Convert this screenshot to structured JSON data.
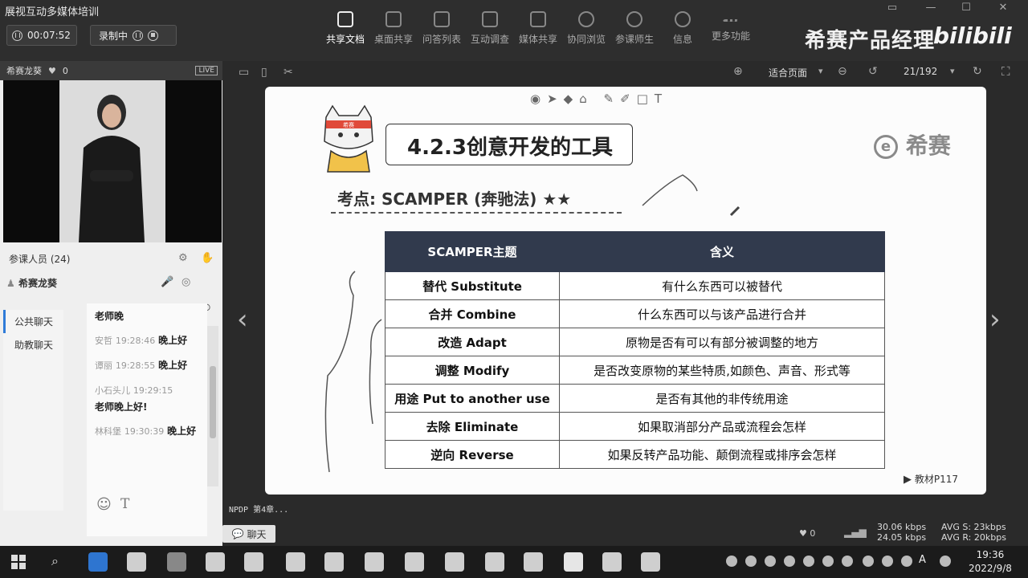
{
  "app": {
    "title": "展视互动多媒体培训",
    "timer": "00:07:52",
    "recording_label": "录制中"
  },
  "toolbar": [
    {
      "label": "共享文档",
      "icon": "document-icon",
      "active": true
    },
    {
      "label": "桌面共享",
      "icon": "desktop-share-icon"
    },
    {
      "label": "问答列表",
      "icon": "qa-icon"
    },
    {
      "label": "互动调查",
      "icon": "survey-icon"
    },
    {
      "label": "媒体共享",
      "icon": "media-icon"
    },
    {
      "label": "协同浏览",
      "icon": "browser-icon"
    },
    {
      "label": "参课师生",
      "icon": "users-icon"
    },
    {
      "label": "信息",
      "icon": "info-icon"
    },
    {
      "label": "更多功能",
      "icon": "more-icon"
    }
  ],
  "brand": {
    "name": "希赛产品经理",
    "bilibili": "bilibili"
  },
  "left_panel": {
    "host_name": "希赛龙葵",
    "likes": "0",
    "live_badge": "LIVE",
    "participants_label": "参课人员 (24)",
    "presenter": "希赛龙葵",
    "chat_tabs": [
      "公共聊天",
      "助教聊天"
    ],
    "chat_messages": [
      {
        "who": "",
        "time": "",
        "text": "老师晚"
      },
      {
        "who": "安哲",
        "time": "19:28:46",
        "text": "晚上好"
      },
      {
        "who": "谭丽",
        "time": "19:28:55",
        "text": "晚上好"
      },
      {
        "who": "小石头儿",
        "time": "19:29:15",
        "text": "老师晚上好!"
      },
      {
        "who": "林科堡",
        "time": "19:30:39",
        "text": "晚上好"
      }
    ]
  },
  "view": {
    "zoom": "适合页面",
    "page": "21/192"
  },
  "slide": {
    "title": "4.2.3创意开发的工具",
    "logo": "希赛",
    "mascot_label": "希赛",
    "subtitle": "考点: SCAMPER (奔驰法) ★★",
    "table": {
      "headers": [
        "SCAMPER主题",
        "含义"
      ],
      "rows": [
        [
          "替代 Substitute",
          "有什么东西可以被替代"
        ],
        [
          "合并 Combine",
          "什么东西可以与该产品进行合并"
        ],
        [
          "改造 Adapt",
          "原物是否有可以有部分被调整的地方"
        ],
        [
          "调整 Modify",
          "是否改变原物的某些特质,如颜色、声音、形式等"
        ],
        [
          "用途 Put to another use",
          "是否有其他的非传统用途"
        ],
        [
          "去除 Eliminate",
          "如果取消部分产品或流程会怎样"
        ],
        [
          "逆向 Reverse",
          "如果反转产品功能、颠倒流程或排序会怎样"
        ]
      ]
    },
    "reference": "教材P117"
  },
  "status": {
    "doc_name": "NPDP 第4章...",
    "chat_button": "聊天",
    "likes": "0",
    "up_rate": "30.06 kbps",
    "down_rate": "24.05 kbps",
    "avg_s": "AVG S: 23kbps",
    "avg_r": "AVG R: 20kbps"
  },
  "taskbar": {
    "time": "19:36",
    "date": "2022/9/8",
    "ime": "A"
  }
}
